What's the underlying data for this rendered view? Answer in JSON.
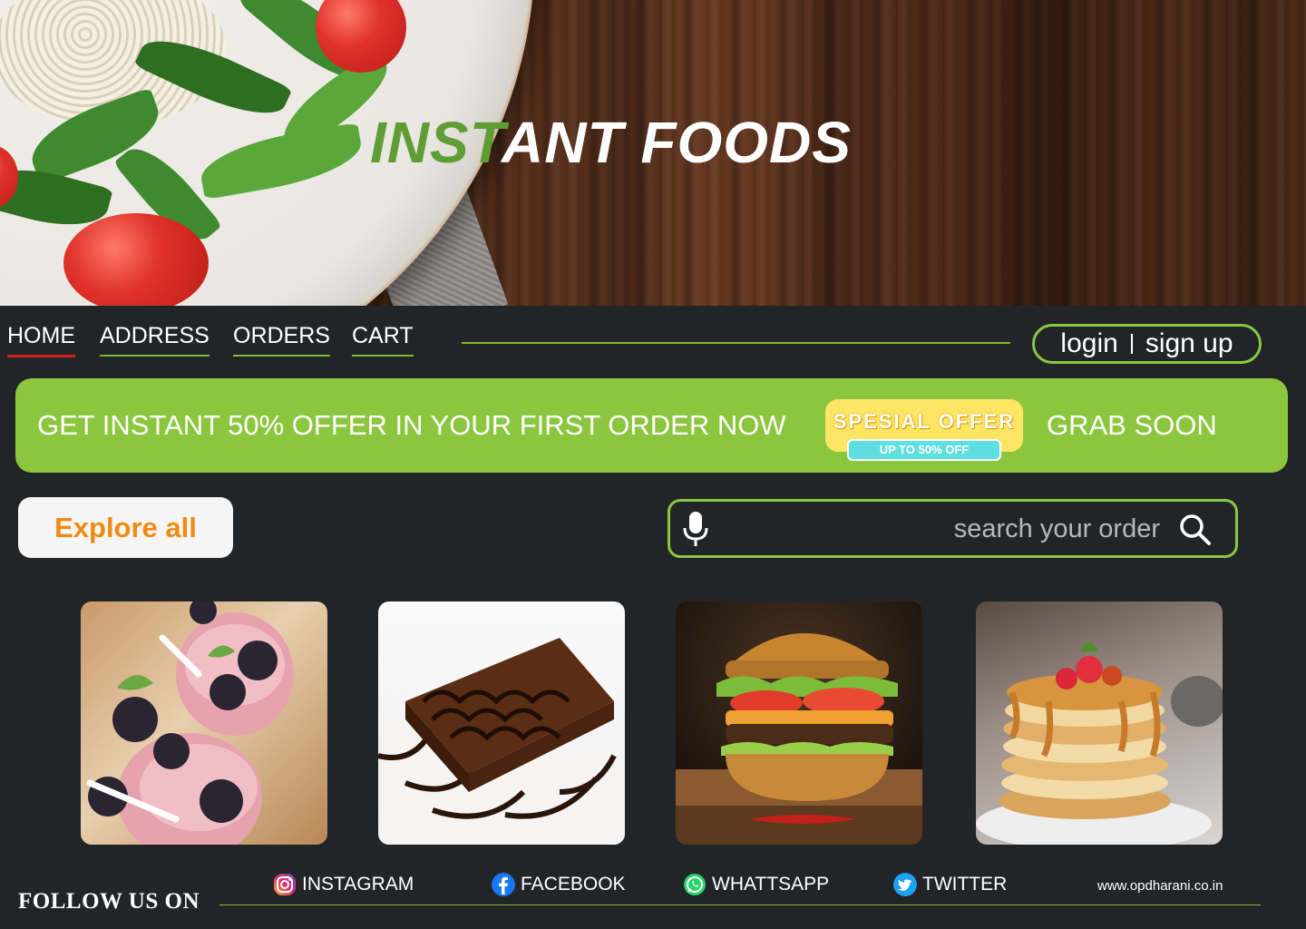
{
  "hero": {
    "title_part1": "INST",
    "title_part2": "ANT FOODS",
    "accent_color": "#5e9e35"
  },
  "nav": {
    "items": [
      {
        "label": "HOME",
        "active": true
      },
      {
        "label": "ADDRESS"
      },
      {
        "label": "ORDERS"
      },
      {
        "label": "CART"
      }
    ],
    "login_label": "login",
    "signup_label": "sign up"
  },
  "promo": {
    "text": "GET INSTANT 50% OFFER IN YOUR FIRST ORDER NOW",
    "badge_title": "SPESIAL OFFER",
    "badge_sub": "UP TO 50% OFF",
    "grab_label": "GRAB SOON",
    "bg_color": "#8cc63f"
  },
  "explore": {
    "label": "Explore all",
    "color": "#f08a12"
  },
  "search": {
    "placeholder": "search your order",
    "value": ""
  },
  "food_cards": [
    {
      "icon": "smoothie-image"
    },
    {
      "icon": "brownie-image"
    },
    {
      "icon": "burger-image"
    },
    {
      "icon": "pancakes-image"
    }
  ],
  "footer": {
    "follow_label": "FOLLOW US ON",
    "social": [
      {
        "label": "INSTAGRAM",
        "icon": "instagram-icon"
      },
      {
        "label": "FACEBOOK",
        "icon": "facebook-icon"
      },
      {
        "label": "WHATTSAPP",
        "icon": "whatsapp-icon"
      },
      {
        "label": "TWITTER",
        "icon": "twitter-icon"
      }
    ],
    "website": "www.opdharani.co.in"
  }
}
